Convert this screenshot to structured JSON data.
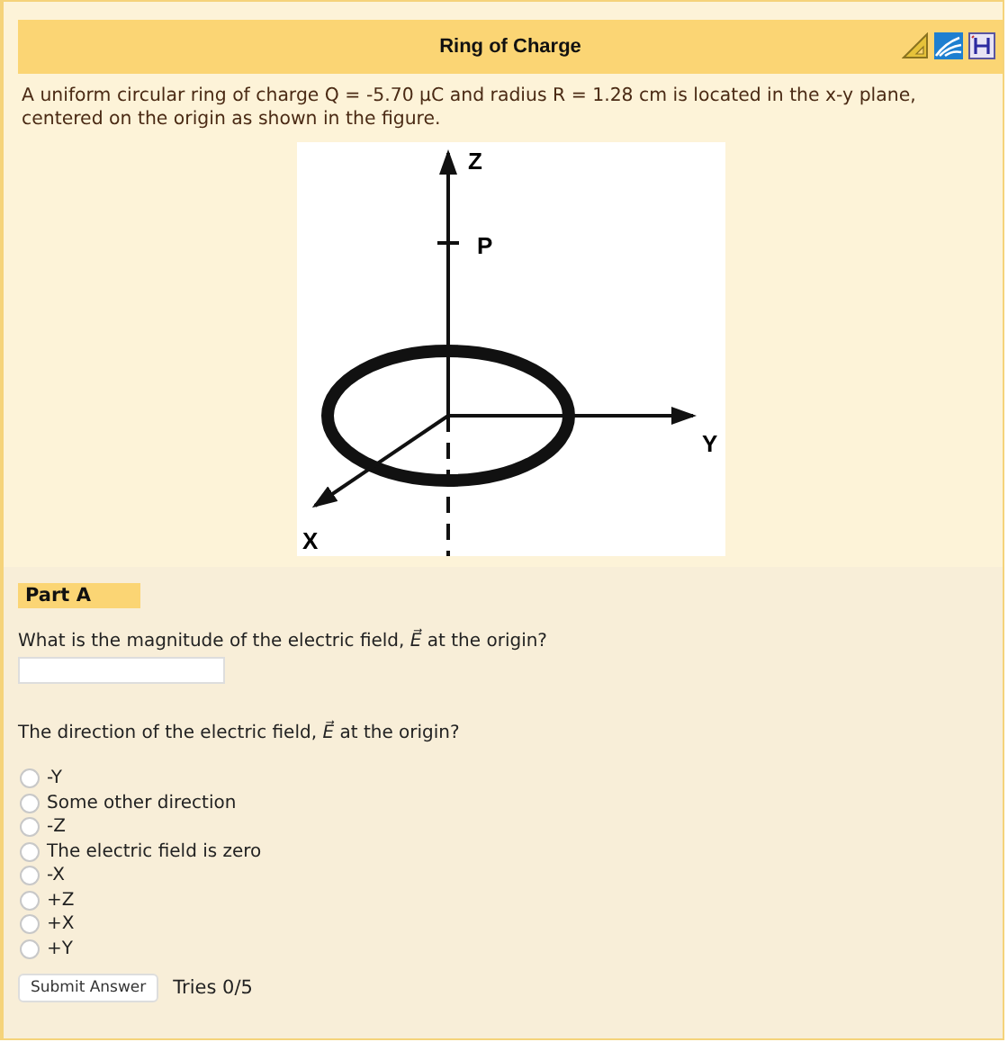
{
  "header": {
    "title": "Ring of Charge"
  },
  "problem": {
    "text": "A uniform circular ring of charge Q = -5.70 μC and radius R = 1.28 cm is located in the x-y plane, centered on the origin as shown in the figure."
  },
  "figure": {
    "labels": [
      "Z",
      "P",
      "Y",
      "X"
    ]
  },
  "part": {
    "label": "Part A",
    "question_1": "What is the magnitude of the electric field, *E⃗* at the origin?",
    "question_2": "The direction of the electric field, *E⃗* at the origin?",
    "options": [
      {
        "label": "-Y",
        "selected": false
      },
      {
        "label": "Some other direction",
        "selected": false
      },
      {
        "label": "-Z",
        "selected": false
      },
      {
        "label": "The electric field is zero",
        "selected": false
      },
      {
        "label": "-X",
        "selected": false
      },
      {
        "label": "+Z",
        "selected": false
      },
      {
        "label": "+X",
        "selected": false
      },
      {
        "label": "+Y",
        "selected": false
      }
    ],
    "submit": "Submit Answer",
    "tries": "Tries 0/5"
  }
}
